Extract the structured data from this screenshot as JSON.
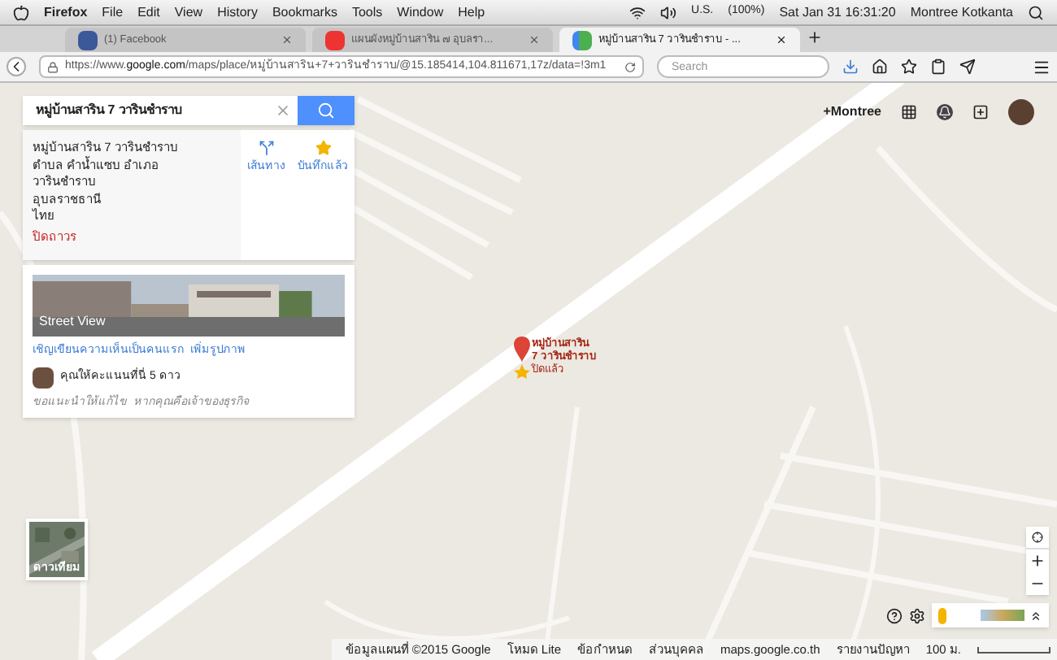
{
  "menu_bar": {
    "app": "Firefox",
    "items": [
      "File",
      "Edit",
      "View",
      "History",
      "Bookmarks",
      "Tools",
      "Window",
      "Help"
    ],
    "input_source": "U.S.",
    "battery": "(100%)",
    "clock": "Sat Jan 31  16:31:20",
    "user": "Montree Kotkanta"
  },
  "tabs": [
    {
      "label": "(1) Facebook",
      "selected": false
    },
    {
      "label": "แผนผังหมู่บ้านสาริน ๗ อุบลรา...",
      "selected": false
    },
    {
      "label": "หมู่บ้านสาริน 7 วารินชำราบ - ...",
      "selected": true
    }
  ],
  "address_bar": {
    "url_prefix": "https://www.",
    "url_domain": "google.com",
    "url_rest": "/maps/place/หมู่บ้านสาริน+7+วารินชำราบ/@15.185414,104.811671,17z/data=!3m1",
    "search_placeholder": "Search"
  },
  "search_box": {
    "value": "หมู่บ้านสาริน 7 วารินชำราบ"
  },
  "place_card": {
    "address_lines": [
      "หมู่บ้านสาริน 7 วารินชำราบ",
      "ตำบล คำน้ำแซบ อำเภอ",
      "วารินชำราบ",
      "อุบลราชธานี",
      "ไทย"
    ],
    "status": "ปิดถาวร",
    "actions": [
      {
        "label": "เส้นทาง",
        "kind": "directions"
      },
      {
        "label": "บันทึกแล้ว",
        "kind": "saved"
      }
    ]
  },
  "street_view_card": {
    "image_label": "Street View",
    "links": [
      "เชิญเขียนความเห็นเป็นคนแรก",
      "เพิ่มรูปภาพ"
    ],
    "rating_text": "คุณให้คะแนนที่นี่ 5 ดาว",
    "suggest_links": [
      "ขอแนะนำให้แก้ไข",
      "หากคุณคือเจ้าของธุรกิจ"
    ]
  },
  "account": {
    "name": "+Montree"
  },
  "marker": {
    "title": "หมู่บ้านสาริน",
    "subtitle": "7 วารินชำราบ",
    "status": "ปิดแล้ว"
  },
  "satellite_toggle": {
    "label": "ดาวเทียม"
  },
  "footer": {
    "items": [
      "ข้อมูลแผนที่ ©2015 Google",
      "โหมด Lite",
      "ข้อกำหนด",
      "ส่วนบุคคล",
      "maps.google.co.th",
      "รายงานปัญหา"
    ],
    "scale": "100 ม."
  }
}
